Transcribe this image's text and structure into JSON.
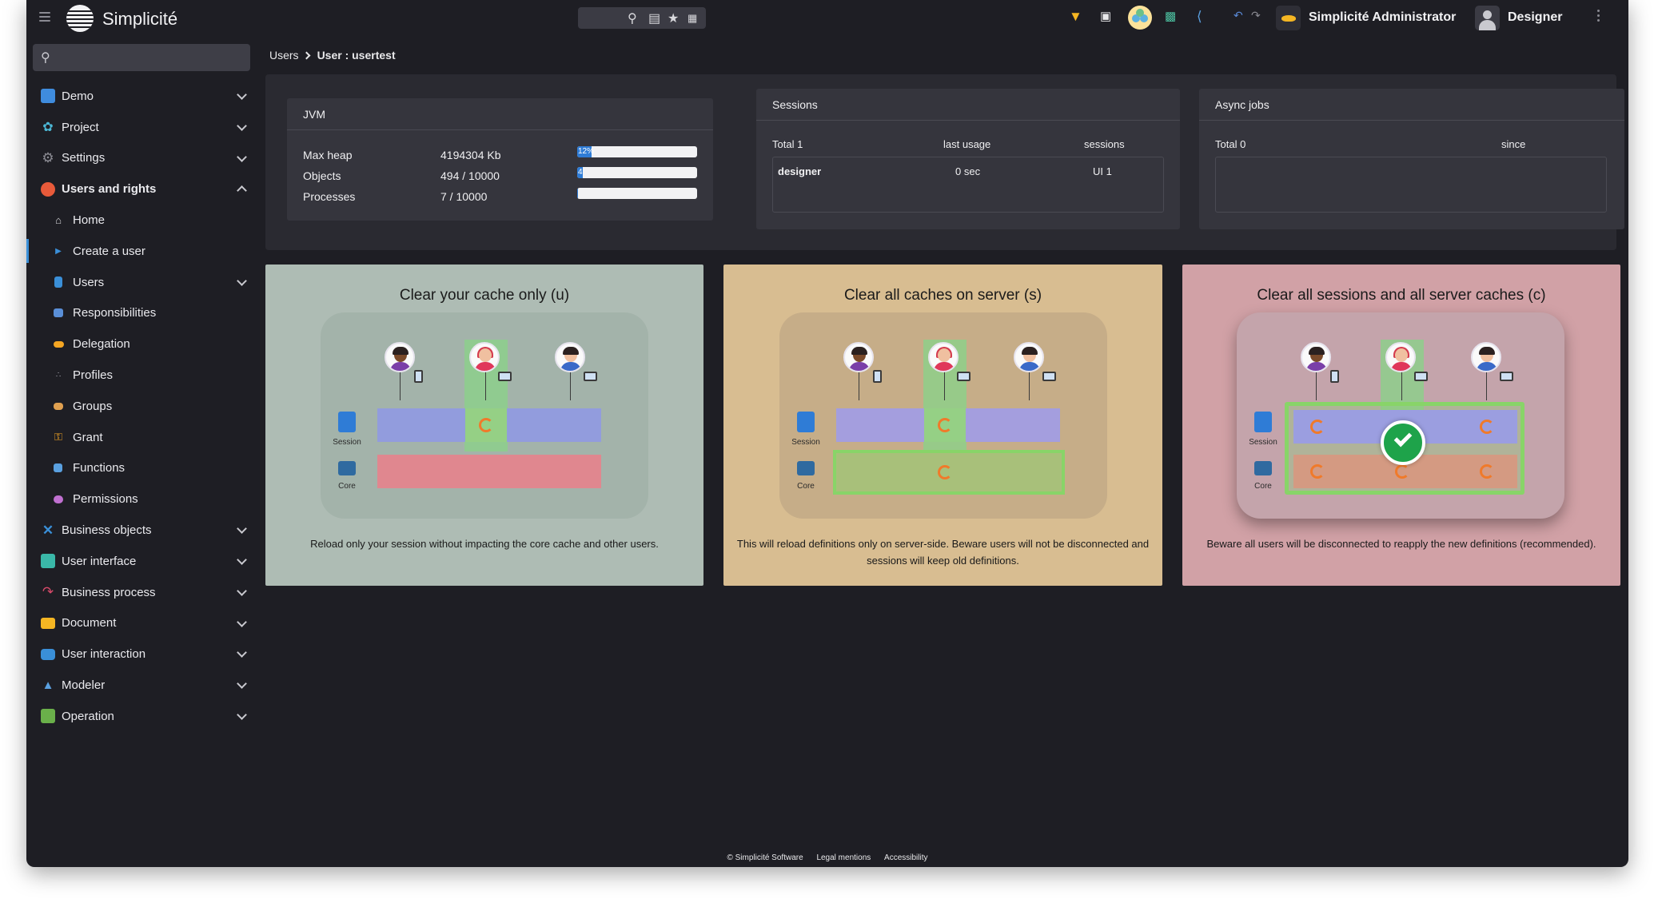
{
  "app": {
    "brand": "Simplicité"
  },
  "topbar": {
    "scope_label": "Simplicité Administrator",
    "user_label": "Designer",
    "icons": [
      "search-icon",
      "list-icon",
      "star-icon",
      "qrcode-icon",
      "filter-icon",
      "flag-icon",
      "collaboration-icon",
      "monitor-icon",
      "share-icon",
      "undo-icon",
      "redo-icon"
    ]
  },
  "sidebar": {
    "search_placeholder": "",
    "items": [
      {
        "label": "Demo",
        "icon": "demo-icon",
        "color": "#3f8cde",
        "expandable": true
      },
      {
        "label": "Project",
        "icon": "project-icon",
        "color": "#4cb8d6",
        "expandable": true
      },
      {
        "label": "Settings",
        "icon": "settings-icon",
        "color": "#8c8c94",
        "expandable": true
      },
      {
        "label": "Users and rights",
        "icon": "users-rights-icon",
        "color": "#e85a3a",
        "expandable": true,
        "expanded": true,
        "children": [
          {
            "label": "Home",
            "icon": "home-icon",
            "color": "#d8d8dc"
          },
          {
            "label": "Create a user",
            "icon": "play-icon",
            "color": "#3a8fd8",
            "active": true
          },
          {
            "label": "Users",
            "icon": "user-icon",
            "color": "#3a8fd8",
            "expandable": true
          },
          {
            "label": "Responsibilities",
            "icon": "responsibility-icon",
            "color": "#5a8fd8"
          },
          {
            "label": "Delegation",
            "icon": "delegation-icon",
            "color": "#f5a623"
          },
          {
            "label": "Profiles",
            "icon": "profiles-icon",
            "color": "#b0b0b8"
          },
          {
            "label": "Groups",
            "icon": "groups-icon",
            "color": "#e0a050"
          },
          {
            "label": "Grant",
            "icon": "key-icon",
            "color": "#f5a623"
          },
          {
            "label": "Functions",
            "icon": "functions-icon",
            "color": "#5aa0e0"
          },
          {
            "label": "Permissions",
            "icon": "permissions-icon",
            "color": "#c070d0"
          }
        ]
      },
      {
        "label": "Business objects",
        "icon": "business-objects-icon",
        "color": "#3a8fd8",
        "expandable": true
      },
      {
        "label": "User interface",
        "icon": "user-interface-icon",
        "color": "#3ab8a8",
        "expandable": true
      },
      {
        "label": "Business process",
        "icon": "business-process-icon",
        "color": "#d84a6a",
        "expandable": true
      },
      {
        "label": "Document",
        "icon": "folder-icon",
        "color": "#f5b623",
        "expandable": true
      },
      {
        "label": "User interaction",
        "icon": "chat-icon",
        "color": "#3a8fd8",
        "expandable": true
      },
      {
        "label": "Modeler",
        "icon": "modeler-icon",
        "color": "#5aa0e0",
        "expandable": true
      },
      {
        "label": "Operation",
        "icon": "operation-icon",
        "color": "#6ab04a",
        "expandable": true
      }
    ]
  },
  "breadcrumb": {
    "parent": "Users",
    "current": "User : usertest"
  },
  "jvm": {
    "title": "JVM",
    "rows": [
      {
        "label": "Max heap",
        "value": "4194304 Kb",
        "fraction": 0.12,
        "badge": "12%"
      },
      {
        "label": "Objects",
        "value": "494 / 10000",
        "fraction": 0.0494,
        "badge": "4"
      },
      {
        "label": "Processes",
        "value": "7 / 10000",
        "fraction": 0.0007,
        "badge": ""
      }
    ]
  },
  "sessions": {
    "title": "Sessions",
    "total": "Total 1",
    "col_usage": "last usage",
    "col_sessions": "sessions",
    "rows": [
      {
        "user": "designer",
        "usage": "0 sec",
        "sessions": "UI 1"
      }
    ]
  },
  "async": {
    "title": "Async jobs",
    "total": "Total 0",
    "col_since": "since"
  },
  "cards": [
    {
      "title": "Clear your cache only (u)",
      "description": "Reload only your session without impacting the core cache and other users.",
      "bg": "#aebcb4"
    },
    {
      "title": "Clear all caches on server (s)",
      "description": "This will reload definitions only on server-side. Beware users will not be disconnected and sessions will keep old definitions.",
      "bg": "#d8bd91"
    },
    {
      "title": "Clear all sessions and all server caches (c)",
      "description": "Beware all users will be disconnected to reapply the new definitions (recommended).",
      "bg": "#d1a1a6"
    }
  ],
  "diagram": {
    "session_label": "Session",
    "core_label": "Core"
  },
  "footer": {
    "copyright": "© Simplicité Software",
    "legal": "Legal mentions",
    "accessibility": "Accessibility"
  }
}
